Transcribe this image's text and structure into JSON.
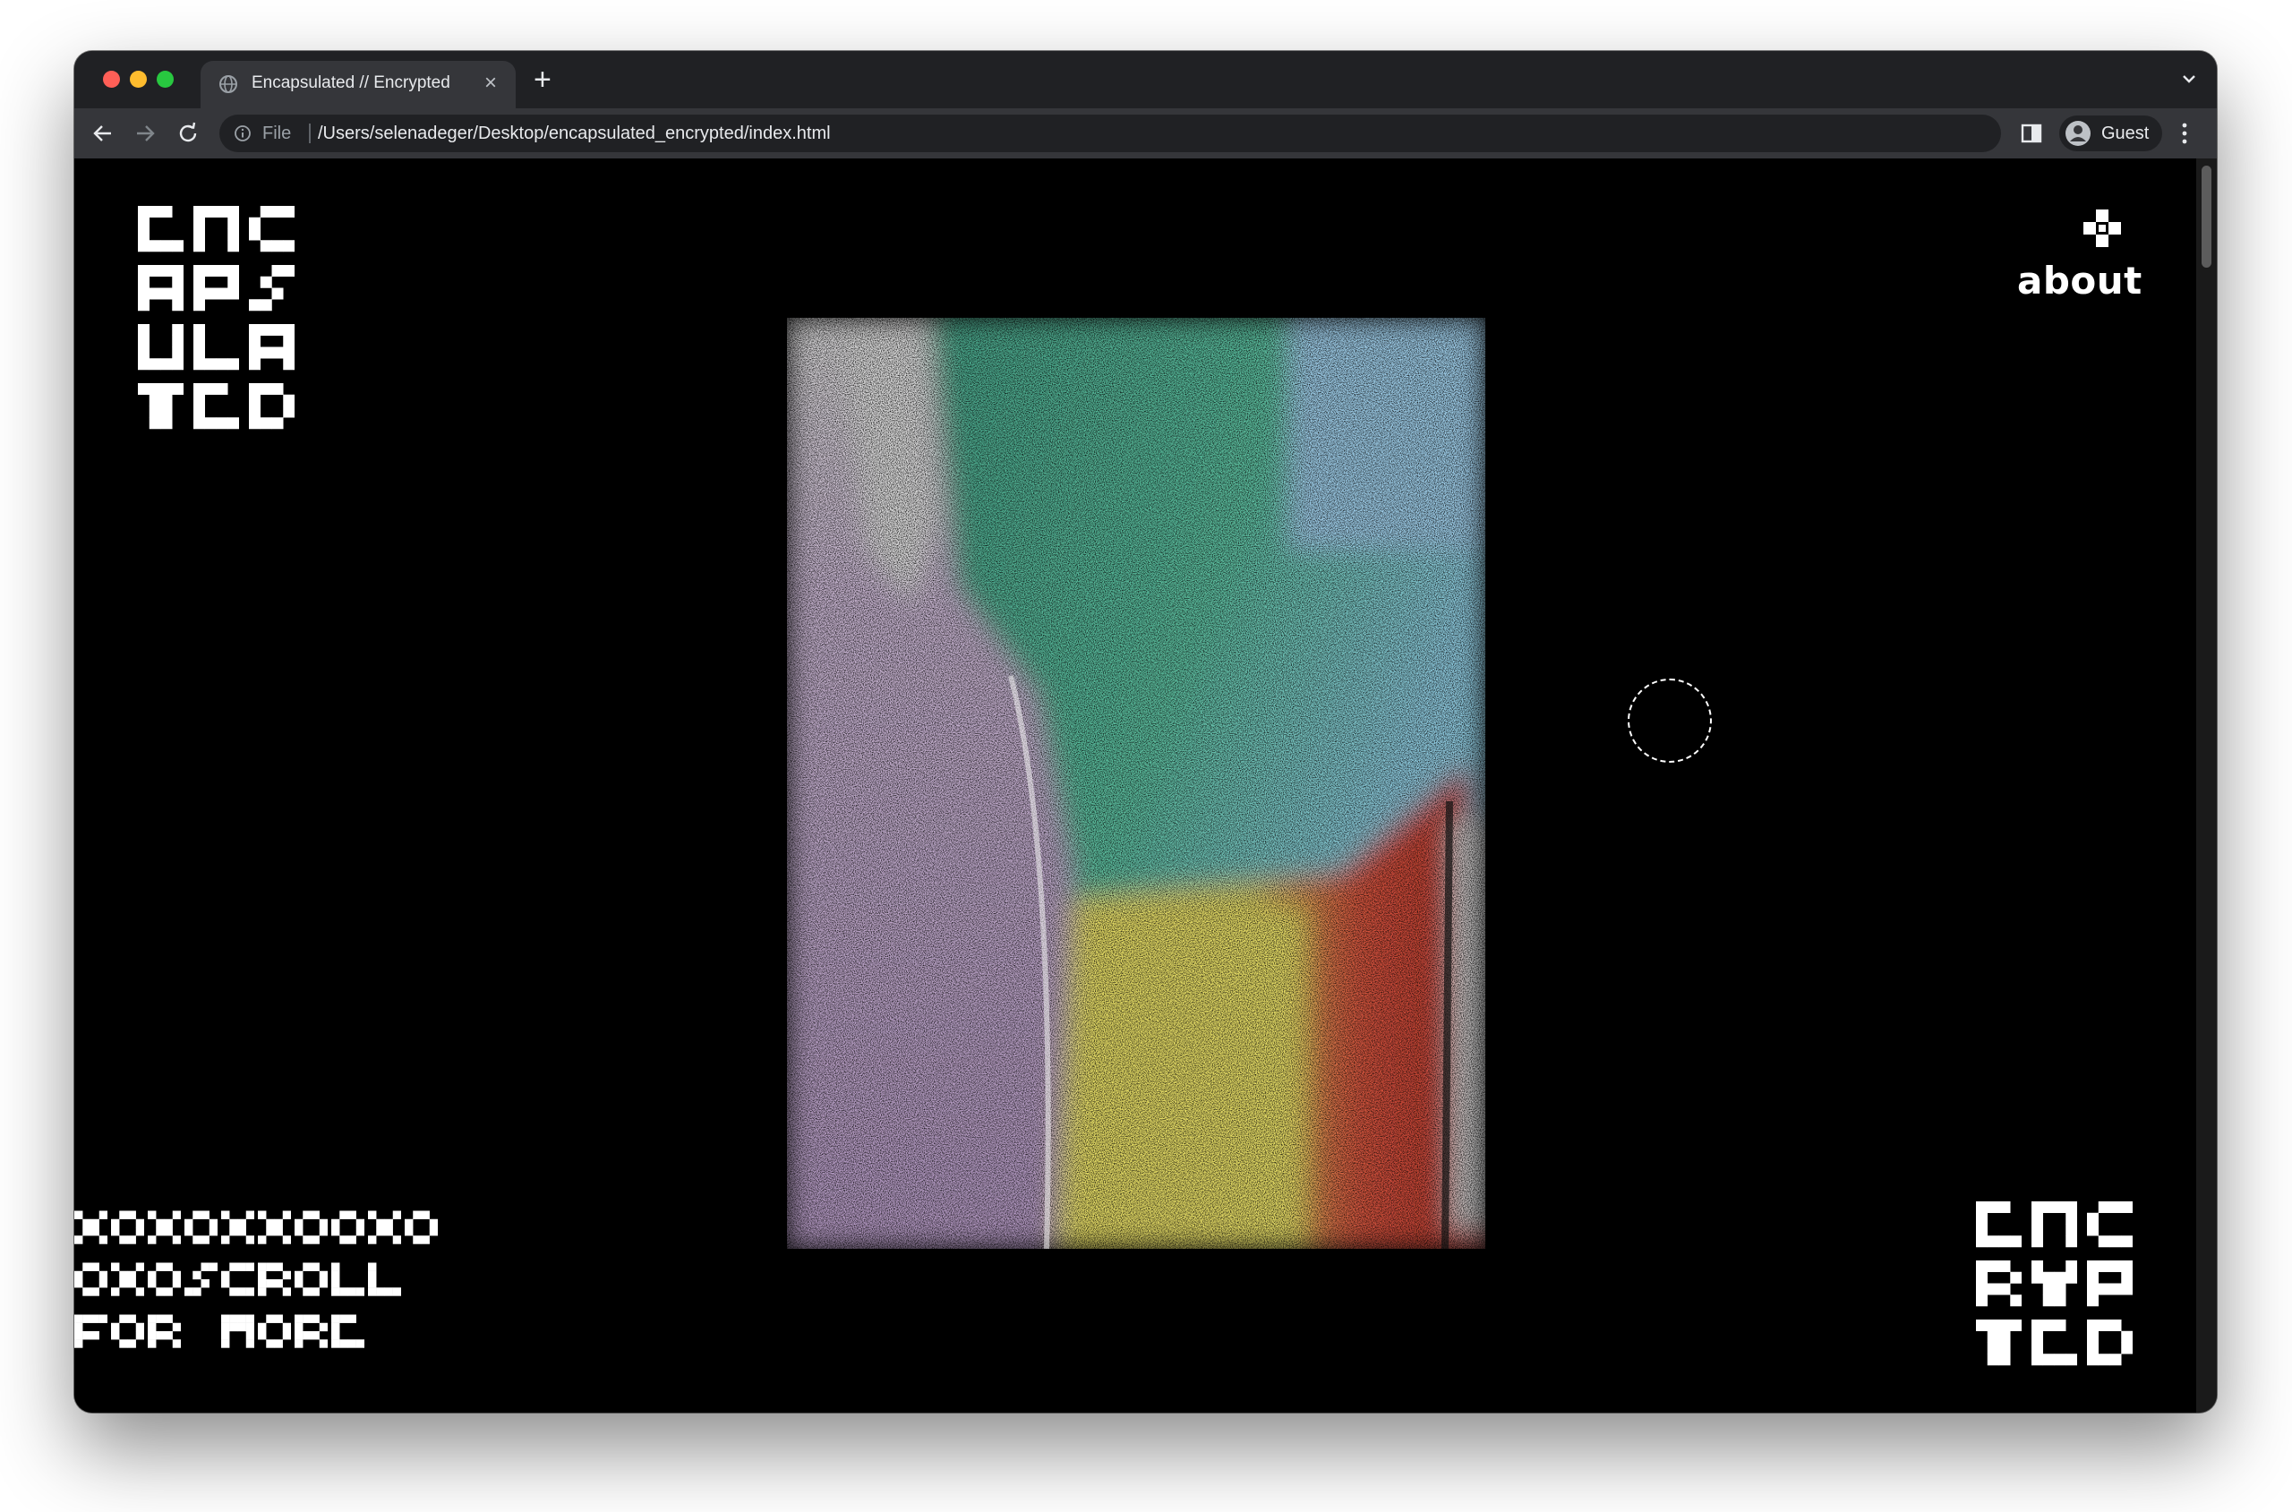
{
  "browser": {
    "tab_title": "Encapsulated // Encrypted",
    "new_tab_symbol": "+",
    "close_symbol": "×",
    "address_scheme": "File",
    "address_url": "/Users/selenadeger/Desktop/encapsulated_encrypted/index.html",
    "profile_label": "Guest",
    "icons": {
      "back": "arrow-left-icon",
      "forward": "arrow-right-icon",
      "reload": "reload-icon",
      "info": "info-icon",
      "side_panel": "side-panel-icon",
      "menu": "kebab-menu-icon",
      "tab_search": "chevron-down-icon"
    },
    "colors": {
      "close": "#ff5f57",
      "minimize": "#febc2e",
      "maximize": "#28c840"
    }
  },
  "page": {
    "logo_top_left": [
      "ENC",
      "APS",
      "ULA",
      "TED"
    ],
    "logo_bottom_right": [
      "ENC",
      "RYP",
      "TED"
    ],
    "scroll_hint": [
      "XOXOXXOOXO",
      "OXOSCROLL",
      "FOR MORE"
    ],
    "about_label": "about",
    "background_color": "#000000",
    "text_color": "#ffffff"
  }
}
